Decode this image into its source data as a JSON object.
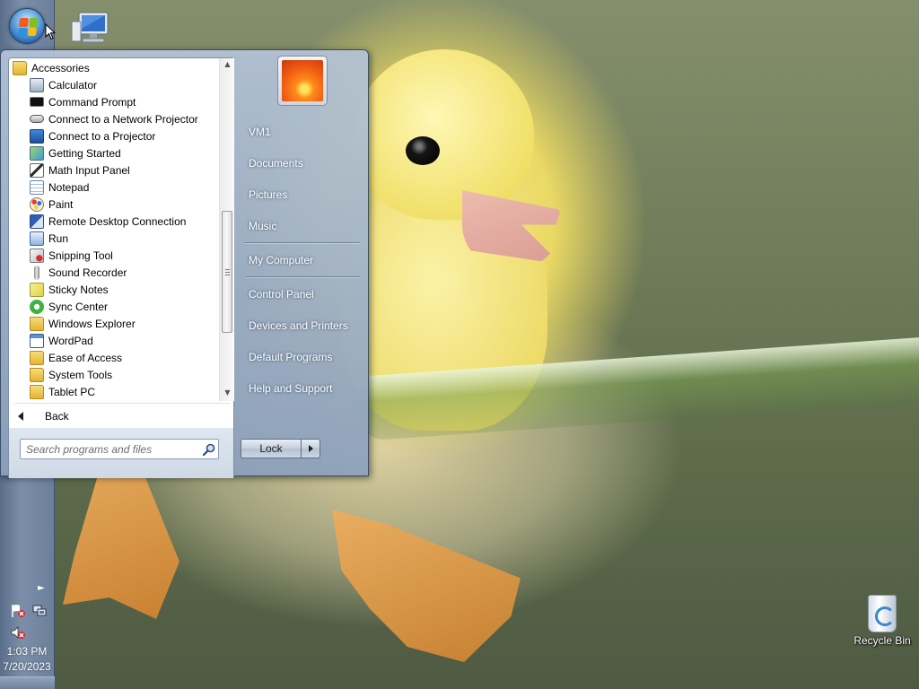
{
  "start_menu": {
    "programs": {
      "folder_label": "Accessories",
      "items": [
        {
          "label": "Calculator",
          "icon": "calculator-icon",
          "kind": "app"
        },
        {
          "label": "Command Prompt",
          "icon": "command-prompt-icon",
          "kind": "app"
        },
        {
          "label": "Connect to a Network Projector",
          "icon": "network-projector-icon",
          "kind": "app"
        },
        {
          "label": "Connect to a Projector",
          "icon": "projector-icon",
          "kind": "app"
        },
        {
          "label": "Getting Started",
          "icon": "getting-started-icon",
          "kind": "app"
        },
        {
          "label": "Math Input Panel",
          "icon": "math-input-icon",
          "kind": "app"
        },
        {
          "label": "Notepad",
          "icon": "notepad-icon",
          "kind": "app"
        },
        {
          "label": "Paint",
          "icon": "paint-icon",
          "kind": "app"
        },
        {
          "label": "Remote Desktop Connection",
          "icon": "remote-desktop-icon",
          "kind": "app"
        },
        {
          "label": "Run",
          "icon": "run-icon",
          "kind": "app"
        },
        {
          "label": "Snipping Tool",
          "icon": "snipping-tool-icon",
          "kind": "app"
        },
        {
          "label": "Sound Recorder",
          "icon": "microphone-icon",
          "kind": "app"
        },
        {
          "label": "Sticky Notes",
          "icon": "sticky-notes-icon",
          "kind": "app"
        },
        {
          "label": "Sync Center",
          "icon": "sync-center-icon",
          "kind": "app"
        },
        {
          "label": "Windows Explorer",
          "icon": "windows-explorer-icon",
          "kind": "app"
        },
        {
          "label": "WordPad",
          "icon": "wordpad-icon",
          "kind": "app"
        },
        {
          "label": "Ease of Access",
          "icon": "folder-icon",
          "kind": "folder"
        },
        {
          "label": "System Tools",
          "icon": "folder-icon",
          "kind": "folder"
        },
        {
          "label": "Tablet PC",
          "icon": "folder-icon",
          "kind": "folder"
        }
      ]
    },
    "back_label": "Back",
    "search": {
      "placeholder": "Search programs and files",
      "value": ""
    },
    "places": {
      "user": "VM1",
      "documents": "Documents",
      "pictures": "Pictures",
      "music": "Music",
      "computer": "My Computer",
      "control_panel": "Control Panel",
      "devices": "Devices and Printers",
      "default_programs": "Default Programs",
      "help": "Help and Support"
    },
    "lock_label": "Lock"
  },
  "taskbar": {
    "clock_time": "1:03 PM",
    "clock_date": "7/20/2023",
    "tray_icons": [
      "action-center-flag-icon",
      "network-icon",
      "volume-muted-icon"
    ]
  },
  "desktop": {
    "icons": [
      {
        "label": "",
        "icon": "computer-icon"
      },
      {
        "label": "Recycle Bin",
        "icon": "recycle-bin-icon"
      }
    ]
  },
  "colors": {
    "taskbar": "#6b7f9b",
    "start_menu_glass": "#9fb1c8",
    "orb_blue": "#2562a8"
  }
}
